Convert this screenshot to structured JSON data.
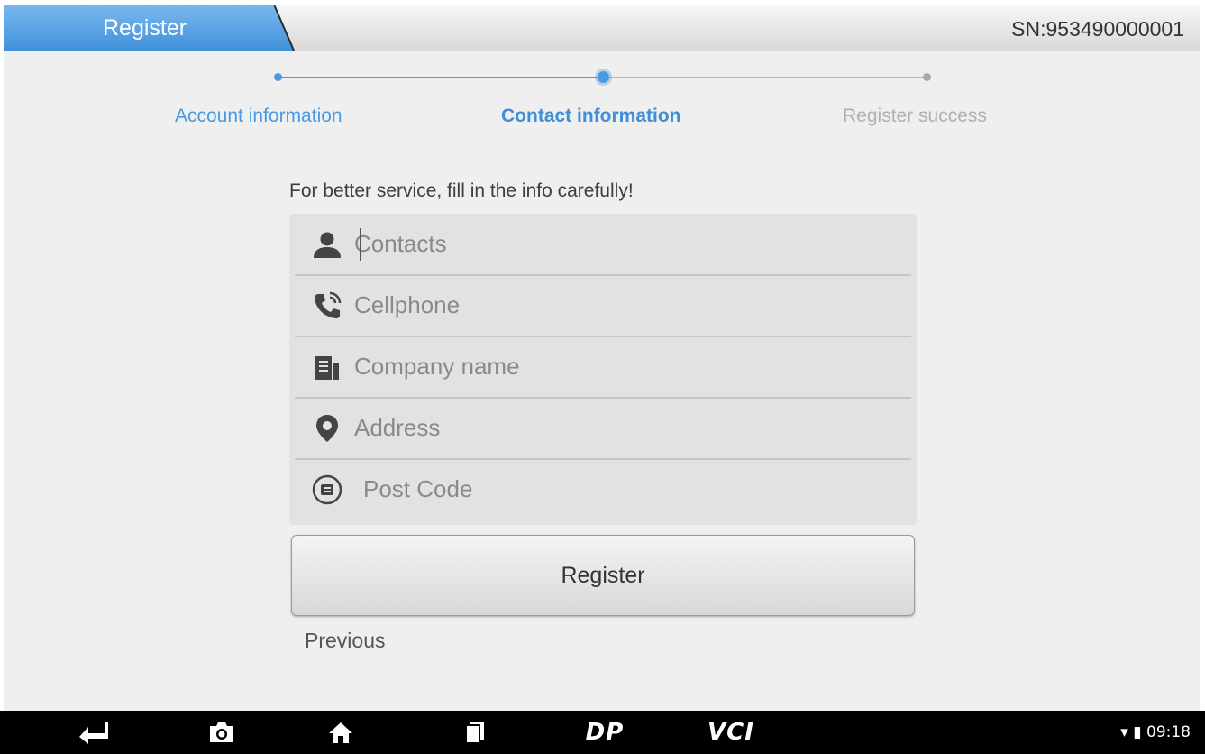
{
  "header": {
    "title": "Register",
    "serial": "SN:953490000001"
  },
  "steps": [
    {
      "label": "Account information",
      "state": "done"
    },
    {
      "label": "Contact information",
      "state": "current"
    },
    {
      "label": "Register success",
      "state": "pending"
    }
  ],
  "form": {
    "hint": "For better service, fill in the info carefully!",
    "fields": [
      {
        "placeholder": "Contacts",
        "icon": "person-icon",
        "value": ""
      },
      {
        "placeholder": "Cellphone",
        "icon": "phone-icon",
        "value": ""
      },
      {
        "placeholder": "Company name",
        "icon": "building-icon",
        "value": ""
      },
      {
        "placeholder": "Address",
        "icon": "location-pin-icon",
        "value": ""
      },
      {
        "placeholder": "Post Code",
        "icon": "mailbox-icon",
        "value": ""
      }
    ],
    "register_label": "Register",
    "previous_label": "Previous"
  },
  "navbar": {
    "icons": [
      "back-icon",
      "camera-icon",
      "home-icon",
      "recent-apps-icon",
      "dp-icon",
      "vci-icon"
    ],
    "dp_label": "DP",
    "vci_label": "VCI",
    "clock": "09:18"
  },
  "colors": {
    "accent": "#4a9ae3",
    "pending": "#b0b0b0",
    "done": "#3f8fd8"
  }
}
